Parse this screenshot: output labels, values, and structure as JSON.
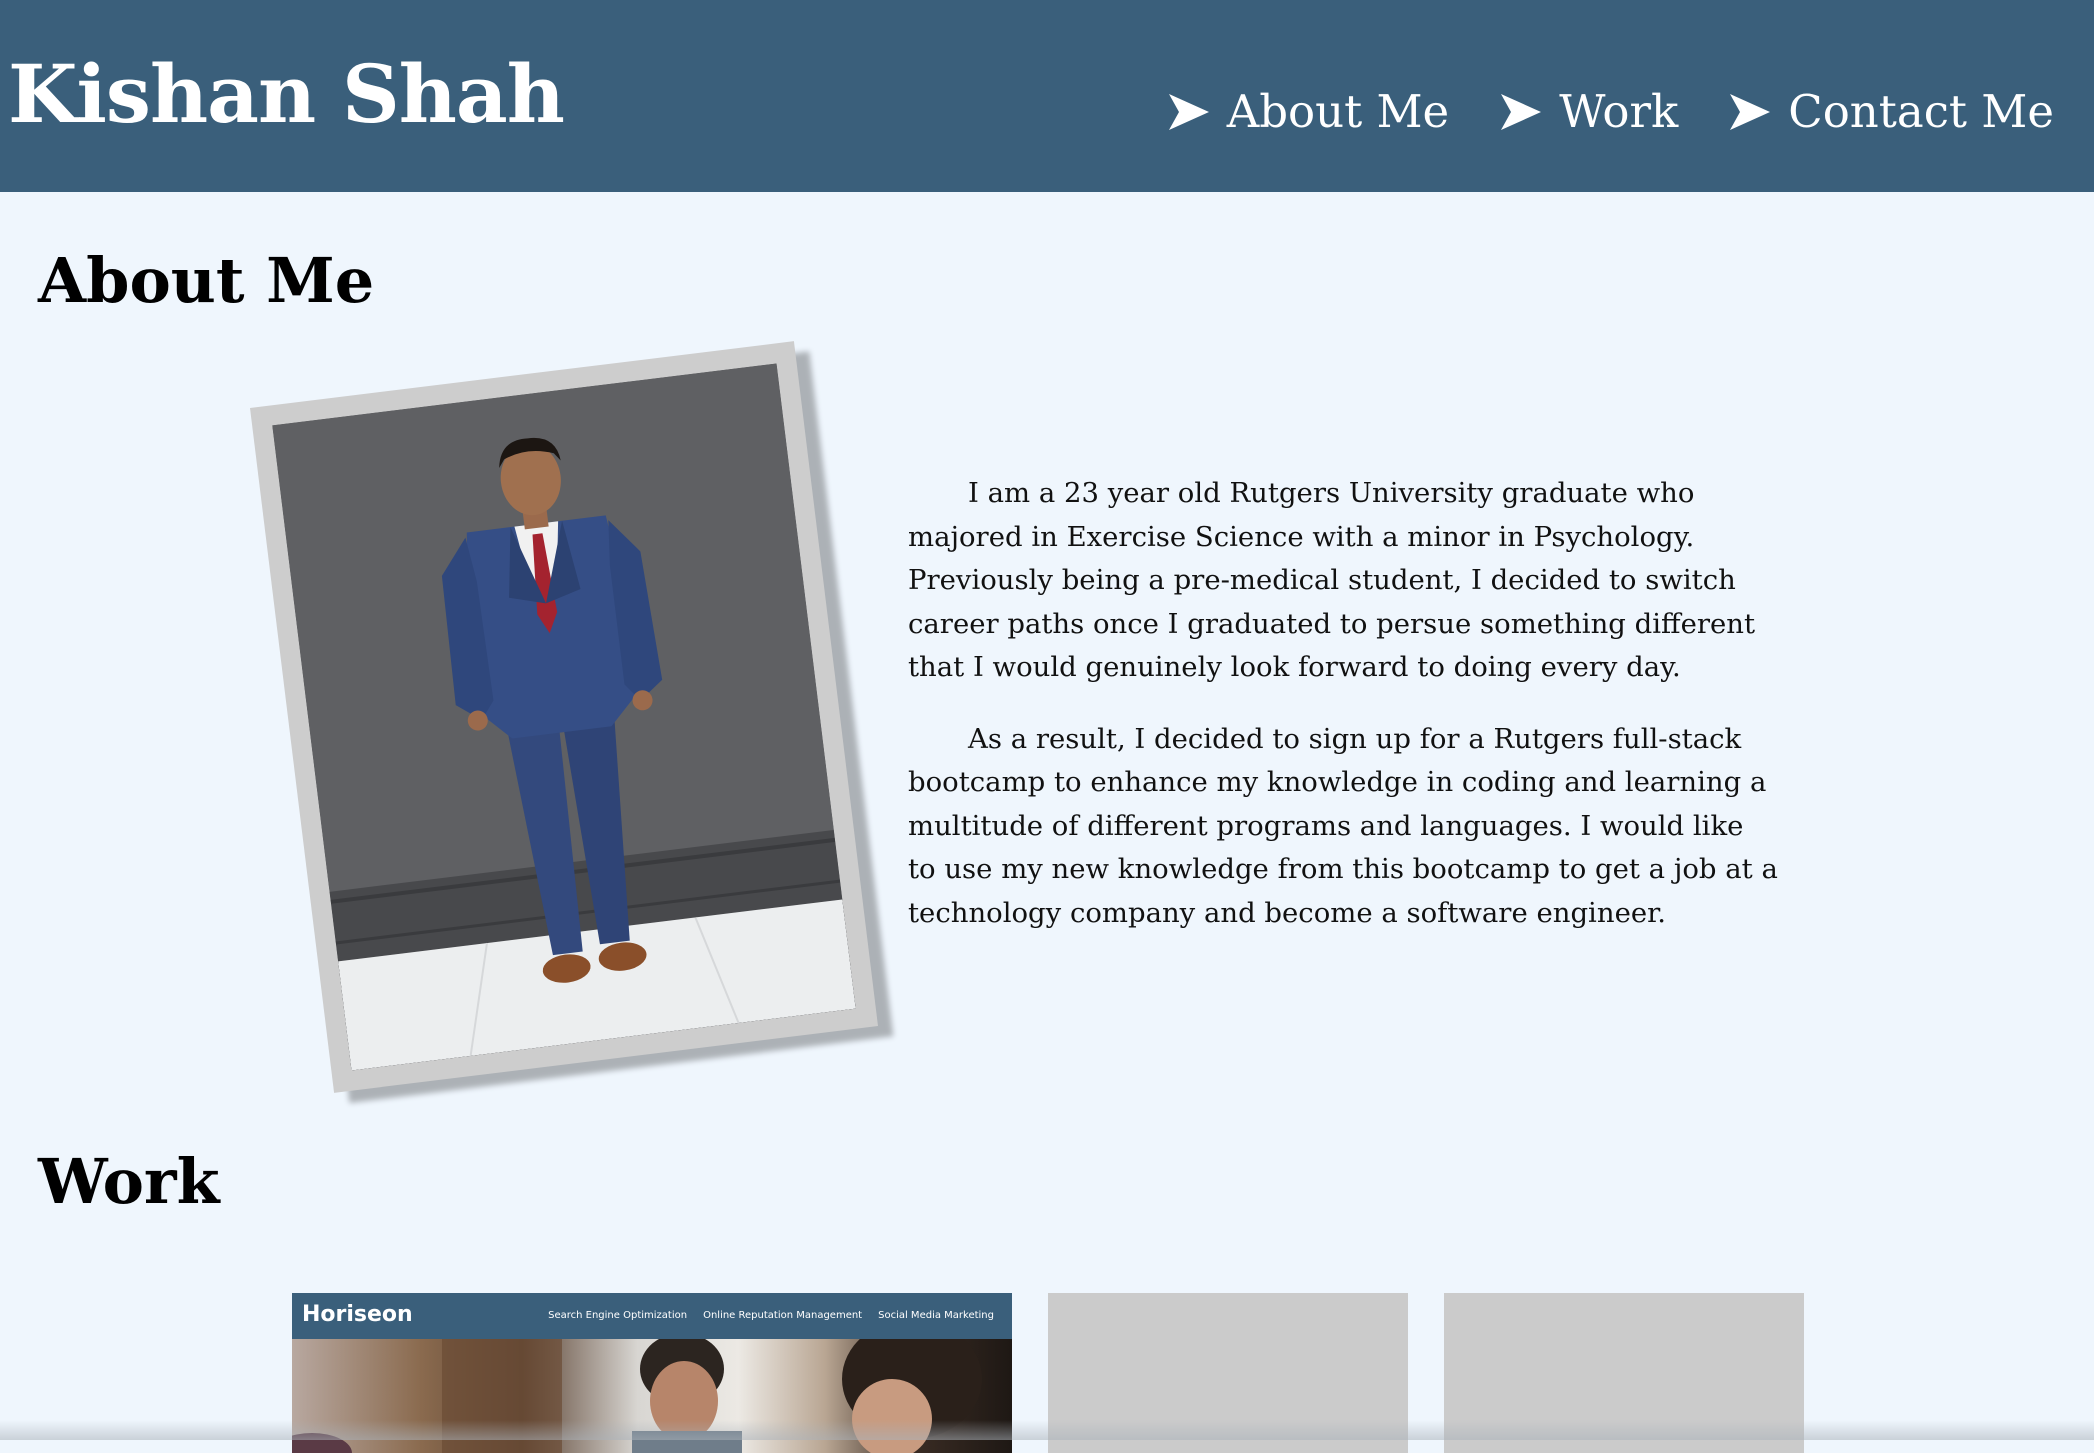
{
  "header": {
    "title": "Kishan Shah",
    "nav": [
      {
        "label": "About Me",
        "icon": "arrow-icon"
      },
      {
        "label": "Work",
        "icon": "arrow-icon"
      },
      {
        "label": "Contact Me",
        "icon": "arrow-icon"
      }
    ]
  },
  "about": {
    "heading": "About Me",
    "paragraphs": [
      "I am a 23 year old Rutgers University graduate who majored in Exercise Science with a minor in Psychology. Previously being a pre-medical student, I decided to switch career paths once I graduated to persue something different that I would genuinely look forward to doing every day.",
      "As a result, I decided to sign up for a Rutgers full-stack bootcamp to enhance my knowledge in coding and learning a multitude of different programs and languages. I would like to use my new knowledge from this bootcamp to get a job at a technology company and become a software engineer."
    ]
  },
  "work": {
    "heading": "Work",
    "project_1": {
      "logo": "Horiseon",
      "links": [
        "Search Engine Optimization",
        "Online Reputation Management",
        "Social Media Marketing"
      ]
    }
  },
  "colors": {
    "header_bg": "#3a5f7b",
    "page_bg": "#eff6fd",
    "placeholder_card": "#cbcbcb"
  }
}
